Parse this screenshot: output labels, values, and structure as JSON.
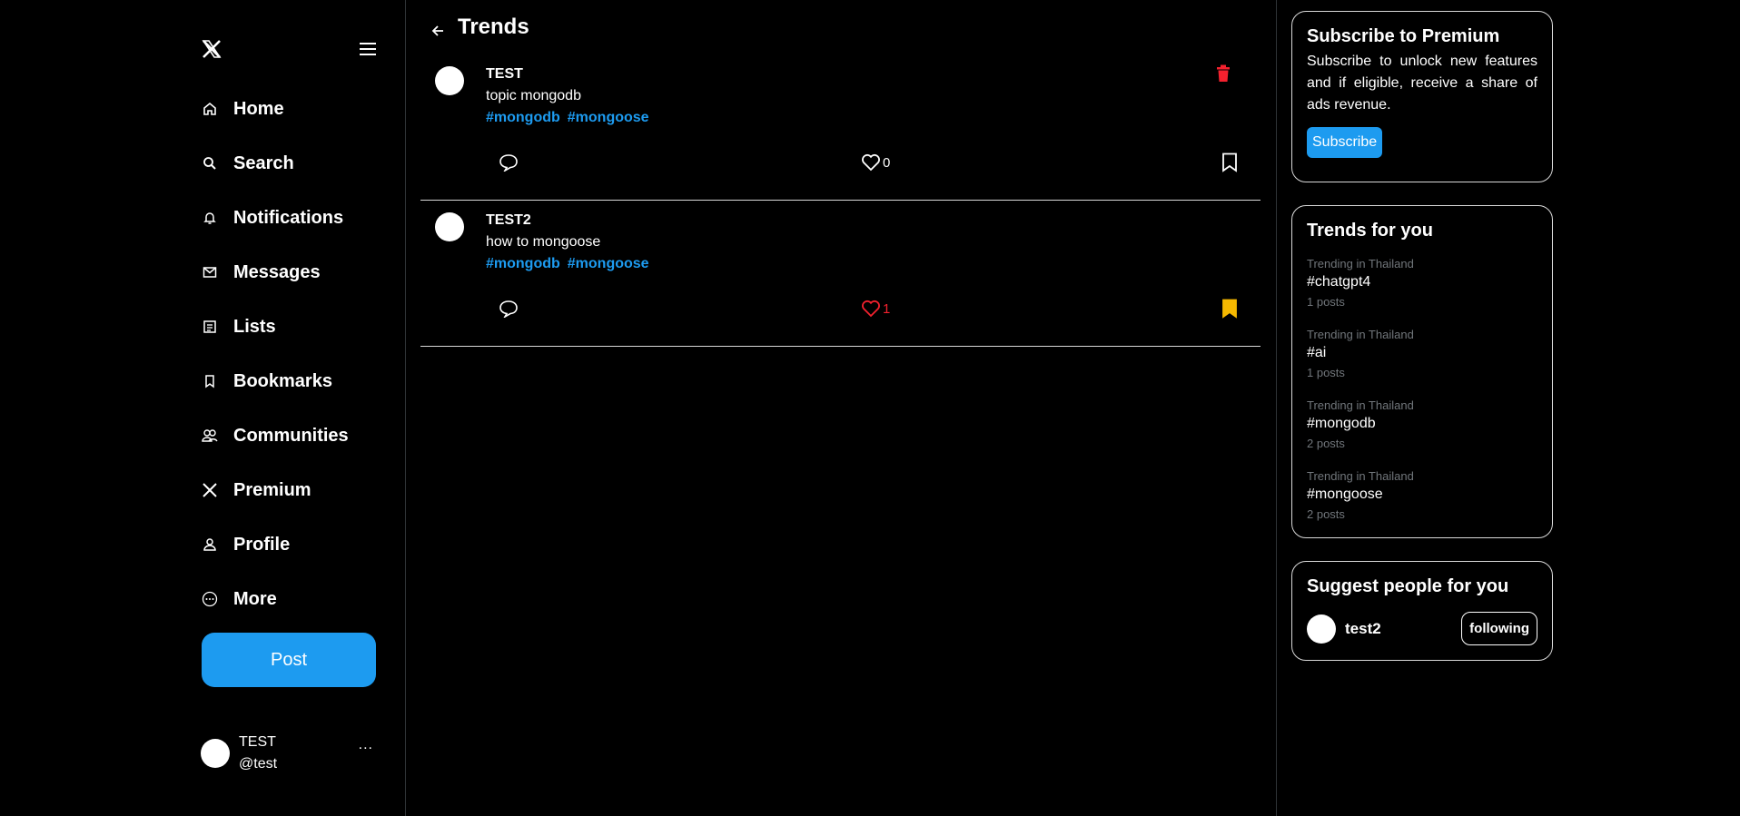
{
  "sidebar": {
    "nav": [
      {
        "label": "Home",
        "icon": "home-icon"
      },
      {
        "label": "Search",
        "icon": "search-icon"
      },
      {
        "label": "Notifications",
        "icon": "bell-icon"
      },
      {
        "label": "Messages",
        "icon": "mail-icon"
      },
      {
        "label": "Lists",
        "icon": "list-icon"
      },
      {
        "label": "Bookmarks",
        "icon": "bookmark-icon"
      },
      {
        "label": "Communities",
        "icon": "people-icon"
      },
      {
        "label": "Premium",
        "icon": "x-logo-icon"
      },
      {
        "label": "Profile",
        "icon": "user-icon"
      },
      {
        "label": "More",
        "icon": "more-circle-icon"
      }
    ],
    "post_label": "Post",
    "account": {
      "name": "TEST",
      "handle": "@test",
      "more": "..."
    }
  },
  "main": {
    "title": "Trends",
    "posts": [
      {
        "user": "TEST",
        "text": "topic mongodb",
        "tags": [
          "#mongodb",
          "#mongoose"
        ],
        "likes": "0",
        "liked": false,
        "bookmarked": false,
        "deletable": true
      },
      {
        "user": "TEST2",
        "text": "how to mongoose",
        "tags": [
          "#mongodb",
          "#mongoose"
        ],
        "likes": "1",
        "liked": true,
        "bookmarked": true,
        "deletable": false
      }
    ]
  },
  "right": {
    "premium": {
      "title": "Subscribe to Premium",
      "body": "Subscribe to unlock new features and if eligible, receive a share of ads revenue.",
      "button": "Subscribe"
    },
    "trends": {
      "title": "Trends for you",
      "items": [
        {
          "context": "Trending in Thailand",
          "tag": "#chatgpt4",
          "count": "1 posts"
        },
        {
          "context": "Trending in Thailand",
          "tag": "#ai",
          "count": "1 posts"
        },
        {
          "context": "Trending in Thailand",
          "tag": "#mongodb",
          "count": "2 posts"
        },
        {
          "context": "Trending in Thailand",
          "tag": "#mongoose",
          "count": "2 posts"
        }
      ]
    },
    "suggest": {
      "title": "Suggest people for you",
      "user": "test2",
      "button": "following"
    }
  },
  "colors": {
    "accent": "#1d9bf0",
    "like": "#f4212e",
    "bookmark": "#f5b800",
    "delete": "#f4212e"
  }
}
